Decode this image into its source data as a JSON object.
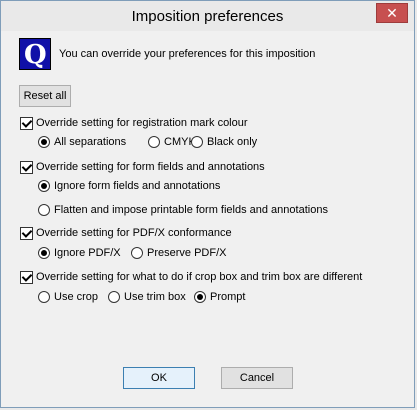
{
  "window": {
    "title": "Imposition preferences"
  },
  "logo": {
    "letter": "Q"
  },
  "intro": "You can override your preferences for this imposition",
  "buttons": {
    "reset_all": "Reset all",
    "ok": "OK",
    "cancel": "Cancel"
  },
  "sections": {
    "registration": {
      "label": "Override setting for registration mark colour",
      "checked": true,
      "options": [
        "All separations",
        "CMYK",
        "Black only"
      ],
      "selected": "All separations"
    },
    "form_fields": {
      "label": "Override setting for form fields and annotations",
      "checked": true,
      "options": [
        "Ignore form fields and annotations",
        "Flatten and impose printable form fields and annotations"
      ],
      "selected": "Ignore form fields and annotations"
    },
    "pdfx": {
      "label": "Override setting for PDF/X conformance",
      "checked": true,
      "options": [
        "Ignore PDF/X",
        "Preserve PDF/X"
      ],
      "selected": "Ignore PDF/X"
    },
    "crop": {
      "label": "Override setting for what to do if crop box and trim box are different",
      "checked": true,
      "options": [
        "Use crop",
        "Use trim box",
        "Prompt"
      ],
      "selected": "Prompt"
    }
  }
}
